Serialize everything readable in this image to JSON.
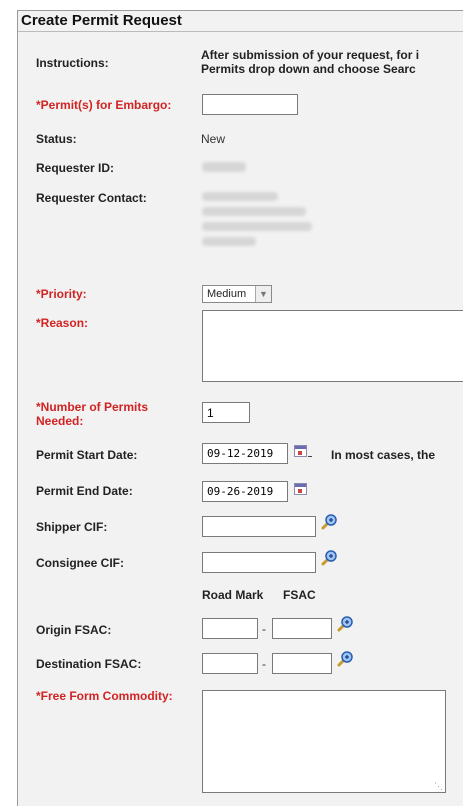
{
  "form": {
    "title": "Create Permit Request",
    "instructions_label": "Instructions:",
    "instructions_line1": "After submission of your request, for i",
    "instructions_line2": "Permits drop down and choose Searc",
    "permits_embargo_label": "*Permit(s) for Embargo:",
    "permits_embargo_value": "",
    "status_label": "Status:",
    "status_value": "New",
    "requester_id_label": "Requester ID:",
    "requester_contact_label": "Requester Contact:",
    "priority_label": "*Priority:",
    "priority_value": "Medium",
    "reason_label": "*Reason:",
    "num_permits_label_1": "*Number of Permits",
    "num_permits_label_2": "Needed:",
    "num_permits_value": "1",
    "start_date_label": "Permit Start Date:",
    "start_date_value": "09-12-2019",
    "start_date_note": "In most cases, the",
    "end_date_label": "Permit End Date:",
    "end_date_value": "09-26-2019",
    "shipper_cif_label": "Shipper CIF:",
    "consignee_cif_label": "Consignee CIF:",
    "road_mark_header": "Road Mark",
    "fsac_header": "FSAC",
    "origin_fsac_label": "Origin FSAC:",
    "destination_fsac_label": "Destination FSAC:",
    "free_form_label": "*Free Form Commodity:",
    "dash": "-"
  },
  "colors": {
    "required": "#d22323",
    "panel_bg": "#f2f2f2"
  },
  "icons": [
    "calendar-icon",
    "lookup-magnifier-icon",
    "dropdown-arrow-icon",
    "resize-grip-icon"
  ]
}
